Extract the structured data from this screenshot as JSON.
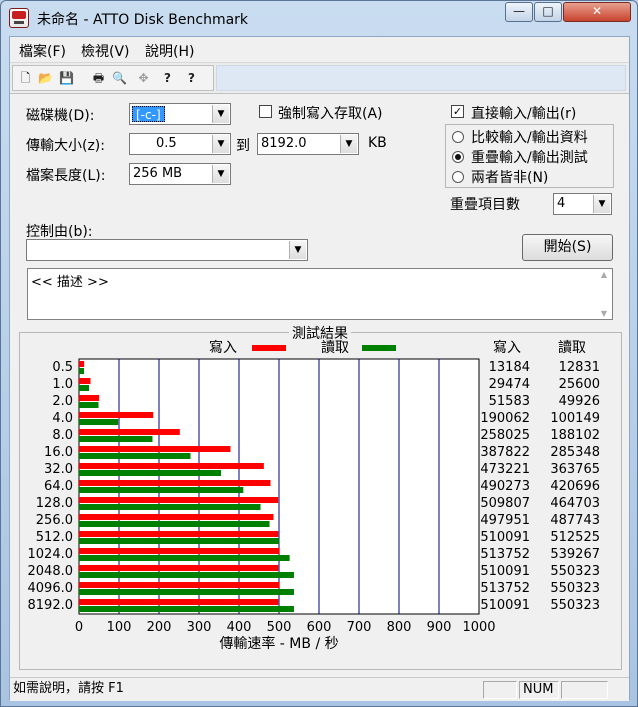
{
  "window": {
    "title": "未命名 - ATTO Disk Benchmark",
    "min_glyph": "—",
    "max_glyph": "□",
    "close_glyph": "✕"
  },
  "menu": [
    "檔案(F)",
    "檢視(V)",
    "說明(H)"
  ],
  "toolbar": {
    "icons": [
      "new-file-icon",
      "open-folder-icon",
      "save-icon",
      "print-icon",
      "print-preview-icon",
      "move-icon",
      "help-icon",
      "context-help-icon"
    ],
    "glyphs": [
      "🗋",
      "📂",
      "💾",
      "🖶",
      "🔍",
      "✥",
      "?",
      "?"
    ]
  },
  "controls": {
    "drive_label": "磁碟機(D):",
    "drive_value": "[-c-]",
    "transfer_label": "傳輸大小(z):",
    "transfer_from": "0.5",
    "to_label": "到",
    "transfer_to": "8192.0",
    "kb_label": "KB",
    "length_label": "檔案長度(L):",
    "length_value": "256 MB",
    "force_write_label": "強制寫入存取(A)",
    "force_write_checked": false,
    "direct_io_label": "直接輸入/輸出(r)",
    "direct_io_checked": true,
    "io_modes": [
      {
        "label": "比較輸入/輸出資料",
        "selected": false
      },
      {
        "label": "重疊輸入/輸出測試",
        "selected": true
      },
      {
        "label": "兩者皆非(N)",
        "selected": false
      }
    ],
    "queue_label": "重疊項目數",
    "queue_value": "4",
    "controlled_by_label": "控制由(b):",
    "controlled_by_value": "",
    "start_button": "開始(S)",
    "description": "<< 描述 >>",
    "check_mark": "✓",
    "dropdown_glyph": "▼",
    "scroll_up_glyph": "▲",
    "scroll_down_glyph": "▼"
  },
  "results": {
    "title": "測試結果",
    "legend_write": "寫入",
    "legend_read": "讀取",
    "col_write": "寫入",
    "col_read": "讀取",
    "write_color": "#ff0000",
    "read_color": "#008000",
    "grid_color": "#000080"
  },
  "chart_data": {
    "type": "bar",
    "orientation": "horizontal",
    "title": "測試結果",
    "xlabel": "傳輸速率 - MB / 秒",
    "ylabel": "",
    "xlim": [
      0,
      1000
    ],
    "xticks": [
      "0",
      "100",
      "200",
      "300",
      "400",
      "500",
      "600",
      "700",
      "800",
      "900",
      "1000"
    ],
    "categories": [
      "0.5",
      "1.0",
      "2.0",
      "4.0",
      "8.0",
      "16.0",
      "32.0",
      "64.0",
      "128.0",
      "256.0",
      "512.0",
      "1024.0",
      "2048.0",
      "4096.0",
      "8192.0"
    ],
    "series": [
      {
        "name": "寫入",
        "values": [
          12.9,
          28.8,
          50.4,
          185.6,
          252.0,
          378.7,
          462.1,
          478.8,
          497.9,
          486.3,
          498.1,
          501.7,
          498.1,
          501.7,
          498.1
        ]
      },
      {
        "name": "讀取",
        "values": [
          12.5,
          25.0,
          48.8,
          97.8,
          183.7,
          278.7,
          355.2,
          410.8,
          453.8,
          476.3,
          500.5,
          526.6,
          537.4,
          537.4,
          537.4
        ]
      }
    ],
    "table_write": [
      "13184",
      "29474",
      "51583",
      "190062",
      "258025",
      "387822",
      "473221",
      "490273",
      "509807",
      "497951",
      "510091",
      "513752",
      "510091",
      "513752",
      "510091"
    ],
    "table_read": [
      "12831",
      "25600",
      "49926",
      "100149",
      "188102",
      "285348",
      "363765",
      "420696",
      "464703",
      "487743",
      "512525",
      "539267",
      "550323",
      "550323",
      "550323"
    ],
    "grid": true,
    "legend": "top-center"
  },
  "statusbar": {
    "help_text": "如需說明，請按 F1",
    "pane2": "",
    "num": "NUM",
    "pane4": ""
  }
}
